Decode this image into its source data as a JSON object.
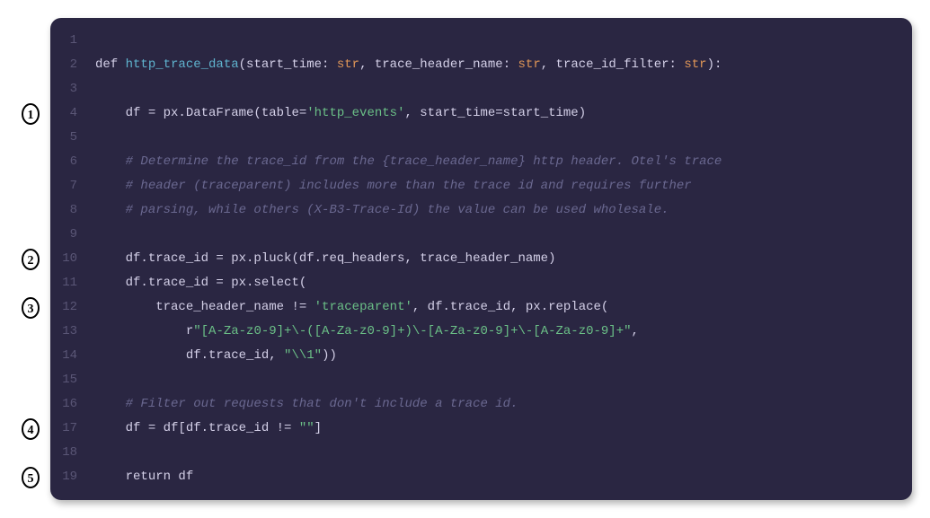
{
  "annotations": {
    "m1": {
      "line": 4,
      "label": "1"
    },
    "m2": {
      "line": 10,
      "label": "2"
    },
    "m3": {
      "line": 12,
      "label": "3"
    },
    "m4": {
      "line": 17,
      "label": "4"
    },
    "m5": {
      "line": 19,
      "label": "5"
    }
  },
  "code": {
    "line1": {
      "num": "1",
      "content": ""
    },
    "line2_num": "2",
    "line2": {
      "def": "def ",
      "fn": "http_trace_data",
      "p1": "(start_time: ",
      "t1": "str",
      "p2": ", trace_header_name: ",
      "t2": "str",
      "p3": ", trace_id_filter: ",
      "t3": "str",
      "p4": "):"
    },
    "line3": {
      "num": "3",
      "content": ""
    },
    "line4_num": "4",
    "line4": {
      "indent": "    ",
      "a": "df = px.DataFrame(table=",
      "s": "'http_events'",
      "b": ", start_time=start_time)"
    },
    "line5": {
      "num": "5",
      "content": ""
    },
    "line6_num": "6",
    "line6": {
      "indent": "    ",
      "c": "# Determine the trace_id from the {trace_header_name} http header. Otel's trace"
    },
    "line7_num": "7",
    "line7": {
      "indent": "    ",
      "c": "# header (traceparent) includes more than the trace id and requires further"
    },
    "line8_num": "8",
    "line8": {
      "indent": "    ",
      "c": "# parsing, while others (X-B3-Trace-Id) the value can be used wholesale."
    },
    "line9": {
      "num": "9",
      "content": ""
    },
    "line10_num": "10",
    "line10": {
      "indent": "    ",
      "a": "df.trace_id = px.pluck(df.req_headers, trace_header_name)"
    },
    "line11_num": "11",
    "line11": {
      "indent": "    ",
      "a": "df.trace_id = px.select("
    },
    "line12_num": "12",
    "line12": {
      "indent": "        ",
      "a": "trace_header_name != ",
      "s": "'traceparent'",
      "b": ", df.trace_id, px.replace("
    },
    "line13_num": "13",
    "line13": {
      "indent": "            ",
      "a": "r",
      "s": "\"[A-Za-z0-9]+\\-([A-Za-z0-9]+)\\-[A-Za-z0-9]+\\-[A-Za-z0-9]+\"",
      "b": ","
    },
    "line14_num": "14",
    "line14": {
      "indent": "            ",
      "a": "df.trace_id, ",
      "s": "\"\\\\1\"",
      "b": "))"
    },
    "line15": {
      "num": "15",
      "content": ""
    },
    "line16_num": "16",
    "line16": {
      "indent": "    ",
      "c": "# Filter out requests that don't include a trace id."
    },
    "line17_num": "17",
    "line17": {
      "indent": "    ",
      "a": "df = df[df.trace_id != ",
      "s": "\"\"",
      "b": "]"
    },
    "line18": {
      "num": "18",
      "content": ""
    },
    "line19_num": "19",
    "line19": {
      "indent": "    ",
      "r": "return",
      "a": " df"
    }
  }
}
